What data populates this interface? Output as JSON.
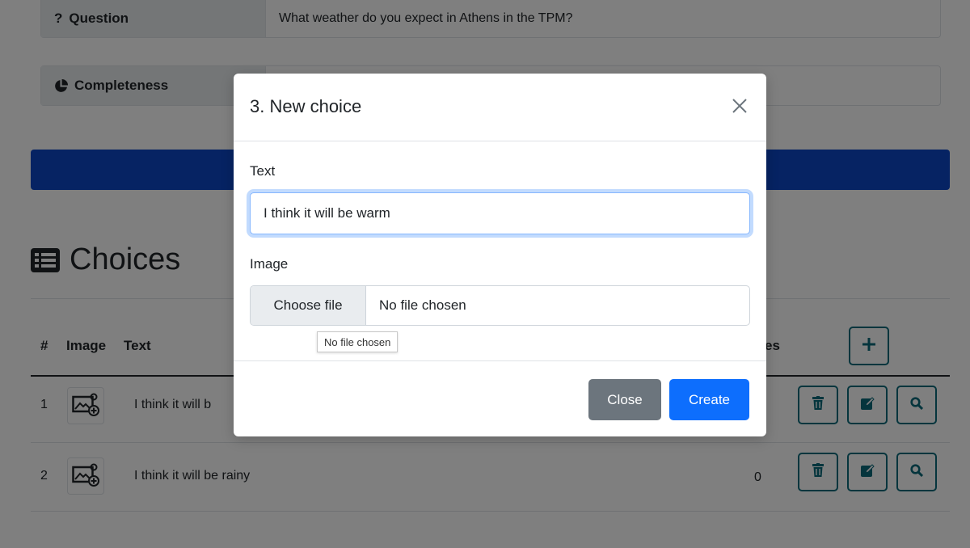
{
  "question": {
    "label": "Question",
    "value": "What weather do you expect in Athens in the TPM?"
  },
  "completeness": {
    "label": "Completeness",
    "value": ""
  },
  "choices": {
    "title": "Choices",
    "columns": {
      "num": "#",
      "image": "Image",
      "text": "Text",
      "votes": "es"
    },
    "rows": [
      {
        "num": "1",
        "text": "I think it will b",
        "votes": ""
      },
      {
        "num": "2",
        "text": "I think it will be rainy",
        "votes": "0"
      }
    ]
  },
  "modal": {
    "title": "3. New choice",
    "text_label": "Text",
    "text_value": "I think it will be warm",
    "image_label": "Image",
    "choose_file": "Choose file",
    "file_status": "No file chosen",
    "tooltip": "No file chosen",
    "close_button": "Close",
    "create_button": "Create"
  },
  "colors": {
    "primary": "#0d6efd",
    "secondary": "#6c757d",
    "banner": "#0d47c7",
    "action_outline": "#0b6a7a"
  },
  "icons": {
    "question": "question-mark-icon",
    "completeness": "pie-chart-icon",
    "choices": "list-icon",
    "add": "plus-icon",
    "delete": "trash-icon",
    "edit": "edit-icon",
    "view": "search-icon",
    "thumbnail": "add-image-icon",
    "close": "close-icon"
  }
}
